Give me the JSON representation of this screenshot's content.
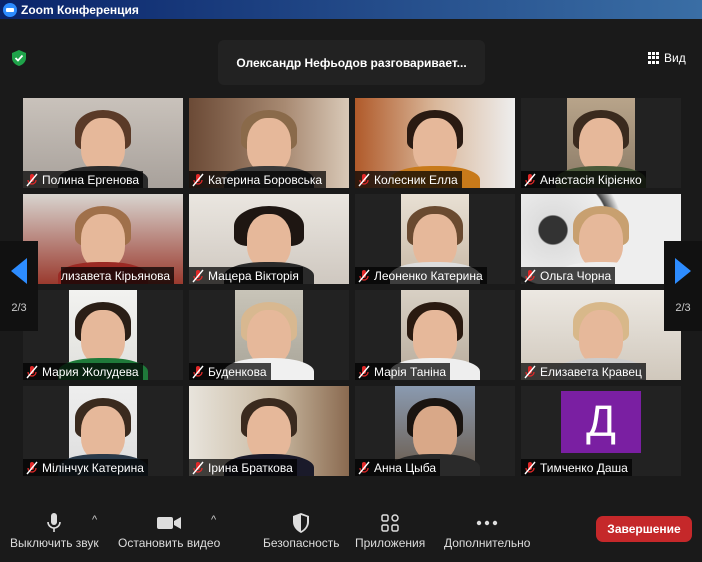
{
  "window": {
    "title": "Zoom Конференция"
  },
  "header": {
    "speaking": "Олександр   Нефьодов разговаривает...",
    "view_label": "Вид"
  },
  "pager": {
    "left_label": "2/3",
    "right_label": "2/3"
  },
  "participants": [
    {
      "name": "Полина Ергенова"
    },
    {
      "name": "Катерина Боровська"
    },
    {
      "name": "Колесник Елла"
    },
    {
      "name": "Анастасія Кірієнко"
    },
    {
      "name": "лизавета Кірьянова"
    },
    {
      "name": "Мацера Вікторія"
    },
    {
      "name": "Леоненко Катерина"
    },
    {
      "name": "Ольга Чорна"
    },
    {
      "name": "Мария Жолудева"
    },
    {
      "name": "Буденкова"
    },
    {
      "name": "Марія Таніна"
    },
    {
      "name": "Елизавета Кравец"
    },
    {
      "name": "Мілінчук Катерина"
    },
    {
      "name": "Ірина Браткова"
    },
    {
      "name": "Анна Цыба"
    },
    {
      "name": "Тимченко Даша",
      "avatar_letter": "Д"
    }
  ],
  "toolbar": {
    "mute_label": "Выключить звук",
    "video_label": "Остановить видео",
    "security_label": "Безопасность",
    "apps_label": "Приложения",
    "more_label": "Дополнительно",
    "end_label": "Завершение"
  },
  "colors": {
    "accent": "#2d8cff",
    "end_button": "#c5282a",
    "mute_icon": "#e02828",
    "avatar_bg": "#7a1fa2",
    "shield": "#1fa34a"
  }
}
